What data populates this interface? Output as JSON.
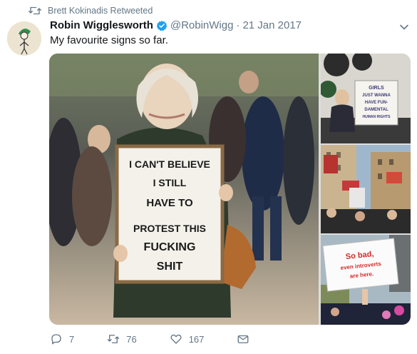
{
  "retweet": {
    "text": "Brett Kokinadis Retweeted",
    "icon": "retweet-icon"
  },
  "author": {
    "name": "Robin Wigglesworth",
    "handle": "@RobinWigg",
    "separator": "·",
    "date": "21 Jan 2017",
    "verified_icon": "verified-badge-icon"
  },
  "tweet": {
    "text": "My favourite signs so far."
  },
  "media": {
    "main_sign_lines": [
      "I CAN'T BELIEVE",
      "I STILL",
      "HAVE TO",
      "PROTEST THIS",
      "FUCKING",
      "SHIT"
    ],
    "thumb1_sign_lines": [
      "GIRLS",
      "JUST WANNA",
      "HAVE FUN-",
      "DAMENTAL",
      "HUMAN RIGHTS"
    ],
    "thumb3_sign_lines": [
      "So bad,",
      "even introverts",
      "are here."
    ]
  },
  "actions": {
    "reply_count": "7",
    "retweet_count": "76",
    "like_count": "167"
  },
  "colors": {
    "accent": "#1da1f2",
    "muted": "#657786",
    "text": "#14171a"
  }
}
